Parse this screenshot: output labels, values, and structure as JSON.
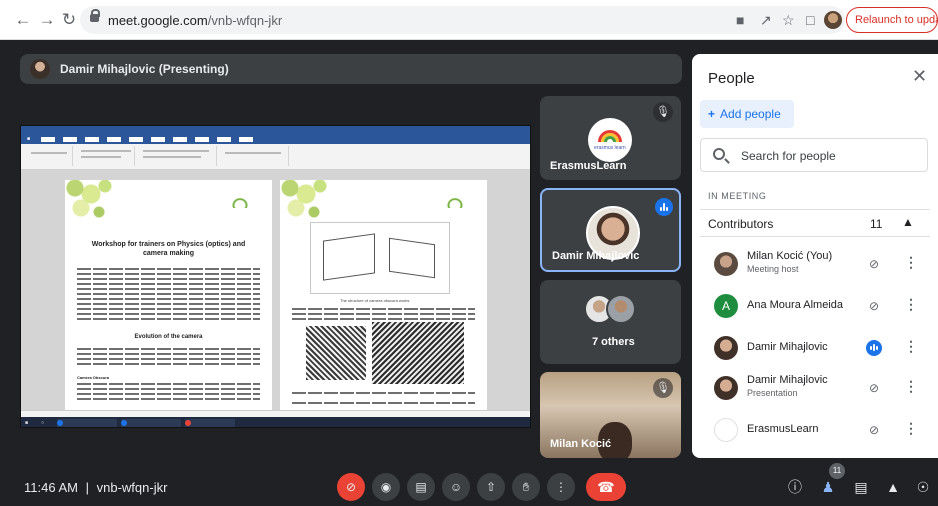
{
  "browser": {
    "url_host": "meet.google.com",
    "url_path": "/vnb-wfqn-jkr",
    "relaunch_label": "Relaunch to update",
    "colors": {
      "relaunch": "#d93025"
    }
  },
  "presenter": {
    "name": "Damir Mihajlovic (Presenting)"
  },
  "shared_screen": {
    "page1_title": "Workshop for trainers on Physics (optics) and camera making",
    "page1_section": "Evolution of the camera",
    "page1_bold": "Camera Obscura",
    "page2_caption": "The structure of camera obscura works"
  },
  "tiles": [
    {
      "name": "ErasmusLearn",
      "logo_text": "erasmus learn",
      "muted": true
    },
    {
      "name": "Damir Mihajlovic",
      "speaking": true
    },
    {
      "name": "7 others"
    },
    {
      "name": "Milan Kocić",
      "muted": true
    }
  ],
  "people_panel": {
    "title": "People",
    "add_people_label": "Add people",
    "search_placeholder": "Search for people",
    "in_meeting_label": "IN MEETING",
    "contributors_label": "Contributors",
    "contributors_count": "11",
    "participants": [
      {
        "name": "Milan Kocić (You)",
        "role": "Meeting host",
        "avatar": "photo",
        "mic": "muted"
      },
      {
        "name": "Ana Moura Almeida",
        "role": "",
        "avatar": "letter-A",
        "avatar_letter": "A",
        "mic": "muted"
      },
      {
        "name": "Damir Mihajlovic",
        "role": "",
        "avatar": "photo",
        "mic": "speaking"
      },
      {
        "name": "Damir Mihajlovic",
        "role": "Presentation",
        "avatar": "photo",
        "mic": "presenting"
      },
      {
        "name": "ErasmusLearn",
        "role": "",
        "avatar": "logo",
        "mic": "muted"
      }
    ]
  },
  "bottom_bar": {
    "time": "11:46 AM",
    "separator": "|",
    "meeting_code": "vnb-wfqn-jkr",
    "people_count": "11",
    "colors": {
      "end_call": "#ea4335",
      "mic_off": "#ea4335",
      "speaking": "#1a73e8"
    }
  }
}
